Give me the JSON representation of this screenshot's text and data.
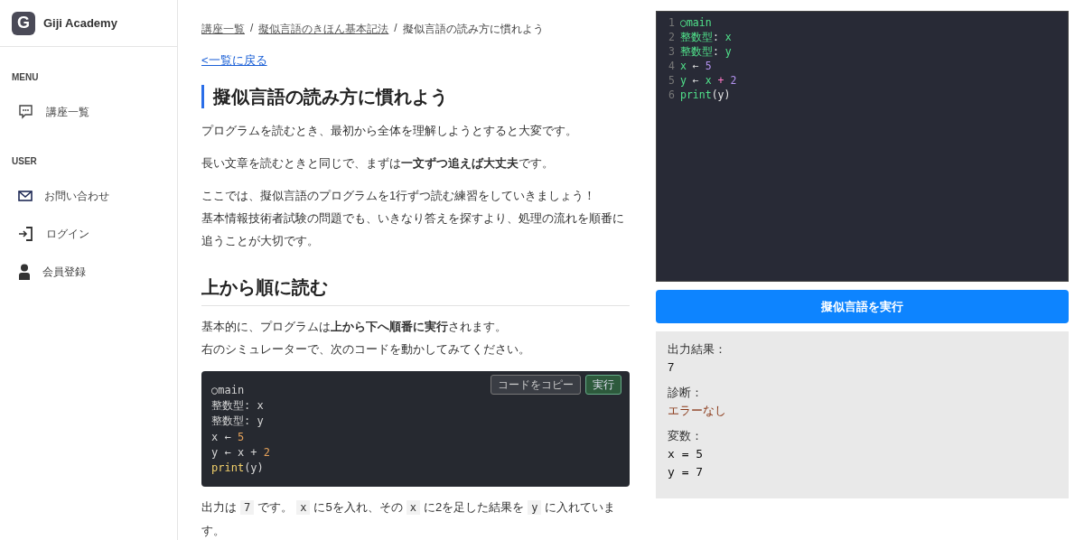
{
  "sidebar": {
    "brand": {
      "logo": "G",
      "name": "Giji Academy"
    },
    "sections": [
      {
        "heading": "MENU",
        "items": [
          {
            "label": "講座一覧"
          }
        ]
      },
      {
        "heading": "USER",
        "items": [
          {
            "label": "お問い合わせ"
          },
          {
            "label": "ログイン"
          },
          {
            "label": "会員登録"
          }
        ]
      }
    ]
  },
  "breadcrumb": [
    {
      "label": "講座一覧",
      "link": true
    },
    {
      "label": "擬似言語のきほん基本記法",
      "link": true
    },
    {
      "label": "擬似言語の読み方に慣れよう",
      "link": false
    }
  ],
  "breadcrumb_separator": "/",
  "back_link": "<一覧に戻る",
  "title": "擬似言語の読み方に慣れよう",
  "intro": [
    [
      "プログラムを読むとき、最初から全体を理解しようとすると大変です。"
    ],
    [
      "長い文章を読むときと同じで、まずは**一文ずつ追えば大丈夫**です。"
    ],
    [
      "ここでは、擬似言語のプログラムを1行ずつ読む練習をしていきましょう！",
      "基本情報技術者試験の問題でも、いきなり答えを探すより、処理の流れを順番に追うことが大切です。"
    ]
  ],
  "section_heading": "上から順に読む",
  "section_text": [
    "基本的に、プログラムは**上から下へ順番に実行**されます。",
    "右のシミュレーターで、次のコードを動かしてみてください。"
  ],
  "snippet": {
    "copy_button": "コードをコピー",
    "run_button": "実行",
    "lines": [
      [
        {
          "kind": "plain",
          "text": "○main"
        }
      ],
      [
        {
          "kind": "plain",
          "text": "整数型: x"
        }
      ],
      [
        {
          "kind": "plain",
          "text": "整数型: y"
        }
      ],
      [
        {
          "kind": "plain",
          "text": "x ← "
        },
        {
          "kind": "number",
          "text": "5"
        }
      ],
      [
        {
          "kind": "plain",
          "text": "y ← x + "
        },
        {
          "kind": "number",
          "text": "2"
        }
      ],
      [
        {
          "kind": "func",
          "text": "print"
        },
        {
          "kind": "plain",
          "text": "(y)"
        }
      ]
    ]
  },
  "explanation": [
    {
      "kind": "text",
      "text": "出力は"
    },
    {
      "kind": "code",
      "text": "7"
    },
    {
      "kind": "text",
      "text": "です。"
    },
    {
      "kind": "code",
      "text": "x"
    },
    {
      "kind": "text",
      "text": "に5を入れ、その"
    },
    {
      "kind": "code",
      "text": "x"
    },
    {
      "kind": "text",
      "text": "に2を足した結果を"
    },
    {
      "kind": "code",
      "text": "y"
    },
    {
      "kind": "text",
      "text": "に入れています。"
    }
  ],
  "editor": {
    "lines": [
      {
        "number": "1",
        "tokens": [
          {
            "kind": "ident",
            "text": "○main"
          }
        ]
      },
      {
        "number": "2",
        "tokens": [
          {
            "kind": "ident",
            "text": "整数型"
          },
          {
            "kind": "punct",
            "text": ": "
          },
          {
            "kind": "ident",
            "text": "x"
          }
        ]
      },
      {
        "number": "3",
        "tokens": [
          {
            "kind": "ident",
            "text": "整数型"
          },
          {
            "kind": "punct",
            "text": ": "
          },
          {
            "kind": "ident",
            "text": "y"
          }
        ]
      },
      {
        "number": "4",
        "tokens": [
          {
            "kind": "ident",
            "text": "x "
          },
          {
            "kind": "punct",
            "text": "← "
          },
          {
            "kind": "number",
            "text": "5"
          }
        ]
      },
      {
        "number": "5",
        "tokens": [
          {
            "kind": "ident",
            "text": "y "
          },
          {
            "kind": "punct",
            "text": "← "
          },
          {
            "kind": "ident",
            "text": "x "
          },
          {
            "kind": "op",
            "text": "+ "
          },
          {
            "kind": "number",
            "text": "2"
          }
        ]
      },
      {
        "number": "6",
        "tokens": [
          {
            "kind": "ident",
            "text": "print"
          },
          {
            "kind": "punct",
            "text": "(y)"
          }
        ]
      }
    ]
  },
  "run_button": "擬似言語を実行",
  "result": {
    "blocks": [
      {
        "label": "出力結果：",
        "kind": "plain",
        "lines": [
          "7"
        ]
      },
      {
        "label": "診断：",
        "kind": "status",
        "lines": [
          "エラーなし"
        ]
      },
      {
        "label": "変数：",
        "kind": "mono",
        "lines": [
          "x = 5",
          "y = 7"
        ]
      }
    ]
  }
}
